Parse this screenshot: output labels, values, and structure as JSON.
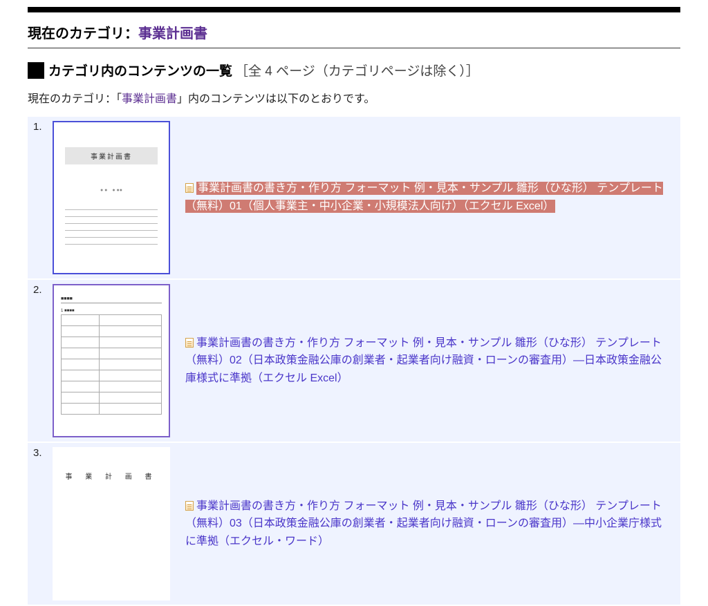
{
  "header": {
    "label": "現在のカテゴリ：",
    "category_name": "事業計画書"
  },
  "subheader": {
    "title": "カテゴリ内のコンテンツの一覧",
    "count_text": "［全 4 ページ（カテゴリページは除く）］"
  },
  "description": {
    "prefix": "現在のカテゴリ：「",
    "link": "事業計画書",
    "suffix": "」内のコンテンツは以下のとおりです。"
  },
  "thumb_labels": {
    "doc1_title": "事業計画書",
    "doc3_title": "事 業 計 画 書"
  },
  "items": [
    {
      "num": "1.",
      "highlight": true,
      "title": "事業計画書の書き方・作り方 フォーマット 例・見本・サンプル 雛形（ひな形） テンプレート（無料）01（個人事業主・中小企業・小規模法人向け）（エクセル Excel）"
    },
    {
      "num": "2.",
      "highlight": false,
      "title": "事業計画書の書き方・作り方 フォーマット 例・見本・サンプル 雛形（ひな形） テンプレート（無料）02（日本政策金融公庫の創業者・起業者向け融資・ローンの審査用）―日本政策金融公庫様式に準拠（エクセル Excel）"
    },
    {
      "num": "3.",
      "highlight": false,
      "title": "事業計画書の書き方・作り方 フォーマット 例・見本・サンプル 雛形（ひな形） テンプレート（無料）03（日本政策金融公庫の創業者・起業者向け融資・ローンの審査用）―中小企業庁様式に準拠（エクセル・ワード）"
    }
  ]
}
